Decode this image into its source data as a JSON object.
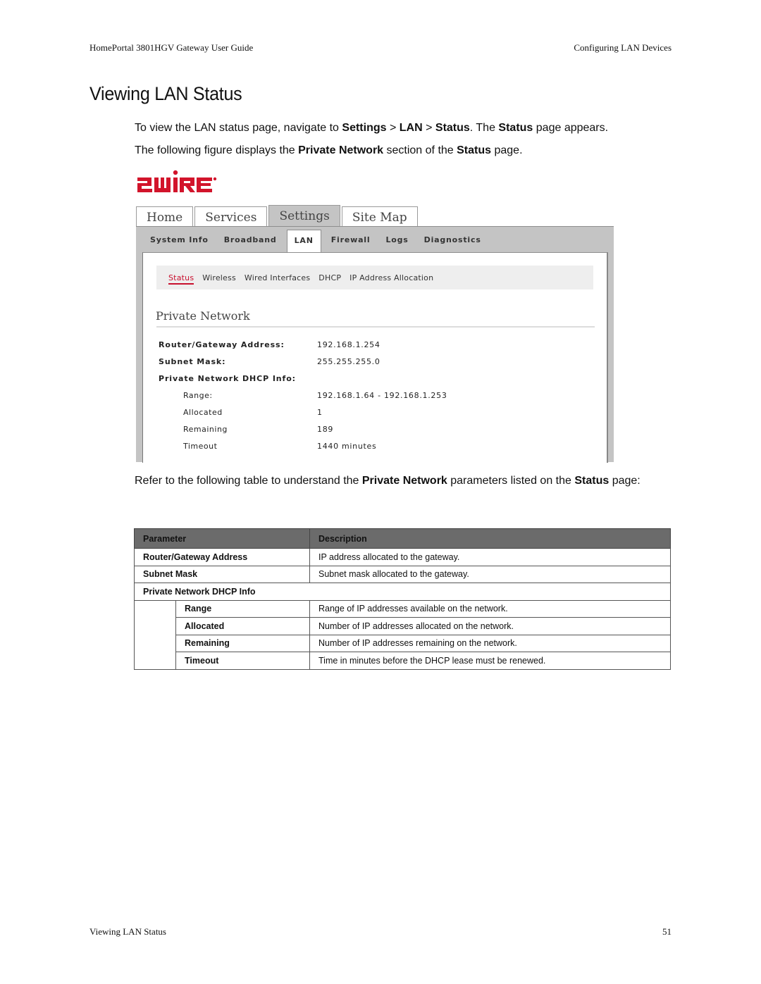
{
  "header": {
    "left": "HomePortal 3801HGV Gateway User Guide",
    "right": "Configuring LAN Devices"
  },
  "title": "Viewing LAN Status",
  "paragraphs": {
    "p1": {
      "t1": "To view the LAN status page, navigate to ",
      "b1": "Settings",
      "t2": " > ",
      "b2": "LAN",
      "t3": " > ",
      "b3": "Status",
      "t4": ". The ",
      "b4": "Status",
      "t5": " page appears."
    },
    "p2": {
      "t1": "The following figure displays the ",
      "b1": "Private Network",
      "t2": " section of the ",
      "b2": "Status",
      "t3": " page."
    },
    "p3": {
      "t1": "Refer to the following table to understand the ",
      "b1": "Private Network",
      "t2": " parameters listed on the ",
      "b2": "Status",
      "t3": " page:"
    }
  },
  "screenshot": {
    "logo_text": "2WIRE",
    "brand_color": "#d2142b",
    "main_tabs": [
      {
        "label": "Home",
        "active": false
      },
      {
        "label": "Services",
        "active": false
      },
      {
        "label": "Settings",
        "active": true
      },
      {
        "label": "Site Map",
        "active": false
      }
    ],
    "sub_tabs": [
      {
        "label": "System Info"
      },
      {
        "label": "Broadband"
      },
      {
        "label": "LAN",
        "active": true
      },
      {
        "label": "Firewall"
      },
      {
        "label": "Logs"
      },
      {
        "label": "Diagnostics"
      }
    ],
    "lan_tabs": [
      {
        "label": "Status",
        "active": true
      },
      {
        "label": "Wireless"
      },
      {
        "label": "Wired Interfaces"
      },
      {
        "label": "DHCP"
      },
      {
        "label": "IP Address Allocation"
      }
    ],
    "section_title": "Private Network",
    "fields": [
      {
        "label": "Router/Gateway Address:",
        "value": "192.168.1.254"
      },
      {
        "label": "Subnet Mask:",
        "value": "255.255.255.0"
      },
      {
        "label": "Private Network DHCP Info:",
        "value": ""
      },
      {
        "label": "Range:",
        "value": "192.168.1.64 - 192.168.1.253"
      },
      {
        "label": "Allocated",
        "value": "1"
      },
      {
        "label": "Remaining",
        "value": "189"
      },
      {
        "label": "Timeout",
        "value": "1440 minutes"
      }
    ]
  },
  "table": {
    "headers": [
      "Parameter",
      "Description"
    ],
    "rows": [
      {
        "param": "Router/Gateway Address",
        "desc": "IP address allocated to the gateway."
      },
      {
        "param": "Subnet Mask",
        "desc": "Subnet mask allocated to the gateway."
      },
      {
        "param": "Private Network DHCP Info",
        "desc": ""
      },
      {
        "param": "Range",
        "desc": "Range of IP addresses available on the network."
      },
      {
        "param": "Allocated",
        "desc": "Number of IP addresses allocated on the network."
      },
      {
        "param": "Remaining",
        "desc": "Number of IP addresses remaining on the network."
      },
      {
        "param": "Timeout",
        "desc": "Time in minutes before the DHCP lease must be renewed."
      }
    ]
  },
  "footer": {
    "left": "Viewing LAN Status",
    "page_number": "51"
  }
}
